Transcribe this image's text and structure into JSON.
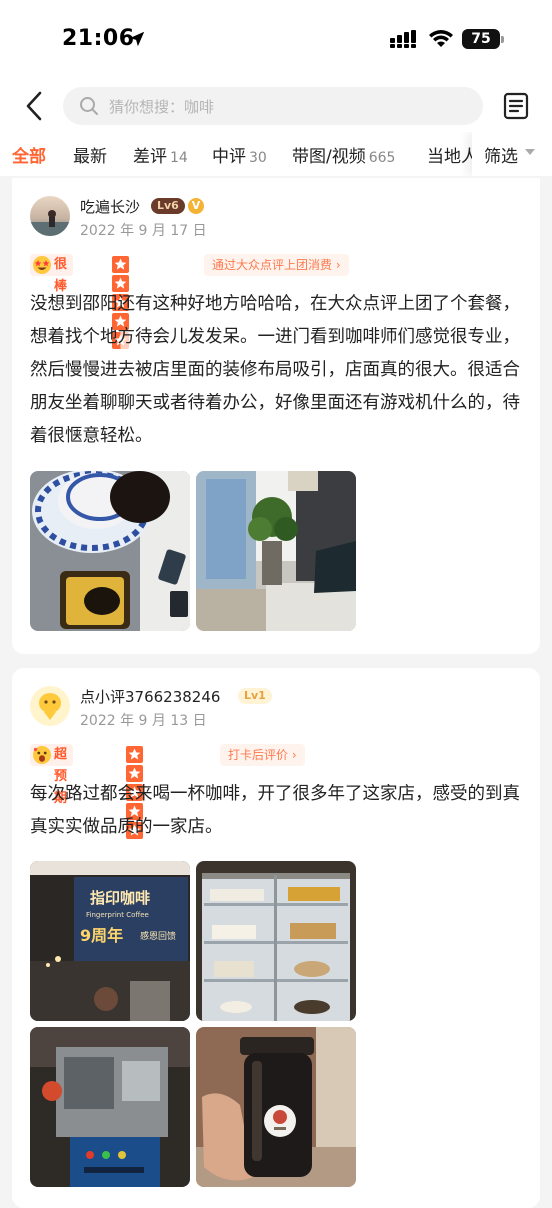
{
  "status_bar": {
    "time": "21:06",
    "battery": "75"
  },
  "search": {
    "placeholder": "猜你想搜：咖啡"
  },
  "tabs": [
    {
      "label": "全部",
      "count": ""
    },
    {
      "label": "最新",
      "count": ""
    },
    {
      "label": "差评",
      "count": "14"
    },
    {
      "label": "中评",
      "count": "30"
    },
    {
      "label": "带图/视频",
      "count": "665"
    },
    {
      "label": "当地人",
      "count": ""
    }
  ],
  "filter_label": "筛选",
  "reviews": [
    {
      "user": "吃遍长沙",
      "level": "Lv6",
      "verified_badge": "V",
      "date": "2022 年 9 月 17 日",
      "mood": "很棒",
      "stars": 4.5,
      "source": "通过大众点评上团消费 ›",
      "text": "没想到邵阳还有这种好地方哈哈哈，在大众点评上团了个套餐，想着找个地方待会儿发发呆。一进门看到咖啡师们感觉很专业，然后慢慢进去被店里面的装修布局吸引，店面真的很大。很适合朋友坐着聊聊天或者待着办公，好像里面还有游戏机什么的，待着很惬意轻松。",
      "photos": [
        "coffee-cup-and-dessert",
        "interior-sofa-plants"
      ]
    },
    {
      "user": "点小评3766238246",
      "level": "Lv1",
      "date": "2022 年 9 月 13 日",
      "mood": "超预期",
      "stars": 5,
      "source": "打卡后评价 ›",
      "text": "每次路过都会来喝一杯咖啡，开了很多年了这家店，感受的到真真实实做品质的一家店。",
      "photos": [
        "shop-sign",
        "pastry-display-fridge",
        "coffee-roaster-machine",
        "cold-brew-bottle"
      ],
      "sign_text": [
        "指印咖啡",
        "Fingerprint Coffee",
        "9周年",
        "感恩回馈"
      ]
    }
  ],
  "colors": {
    "accent": "#ff6633",
    "background": "#f4f4f4"
  }
}
